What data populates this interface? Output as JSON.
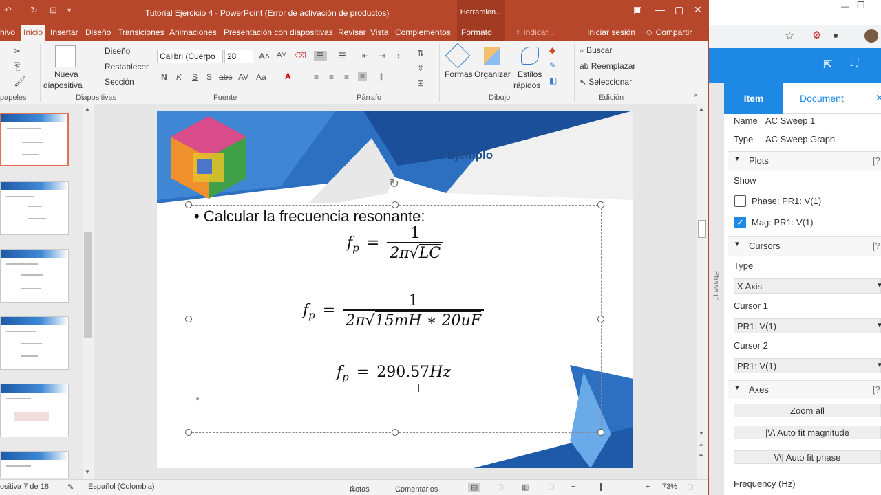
{
  "window": {
    "title": "Tutorial Ejercicio 4 - PowerPoint (Error de activación de productos)",
    "context_header": "Herramien...",
    "signin": "Iniciar sesión",
    "share": "Compartir"
  },
  "tabs": {
    "archivo": "hivo",
    "inicio": "Inicio",
    "insertar": "Insertar",
    "diseno": "Diseño",
    "transiciones": "Transiciones",
    "animaciones": "Animaciones",
    "presentacion": "Presentación con diapositivas",
    "revisar": "Revisar",
    "vista": "Vista",
    "complementos": "Complementos",
    "formato": "Formato",
    "indicar": "Indicar..."
  },
  "ribbon": {
    "nueva": "Nueva",
    "diapositiva": "diapositiva",
    "disenio": "Diseño",
    "restablecer": "Restablecer",
    "seccion": "Sección",
    "font_name": "Calibri (Cuerpo",
    "font_size": "28",
    "formas": "Formas",
    "organizar": "Organizar",
    "estilos": "Estilos",
    "rapidos": "rápidos",
    "buscar": "Buscar",
    "reemplazar": "Reemplazar",
    "seleccionar": "Seleccionar",
    "group_portapapeles": "papeles",
    "group_diapositivas": "Diapositivas",
    "group_fuente": "Fuente",
    "group_parrafo": "Párrafo",
    "group_dibujo": "Dibujo",
    "group_edicion": "Edición"
  },
  "slide": {
    "header": "Ejemplo",
    "bullet": "Calcular la frecuencia resonante:",
    "eq1_lhs": "f",
    "eq1_sub": "p",
    "eq1_num": "1",
    "eq1_den_a": "2π",
    "eq1_den_b": "LC",
    "eq2_num": "1",
    "eq2_den_a": "2π",
    "eq2_den_b": "15mH ∗ 20uF",
    "eq3_rhs_a": "290.57",
    "eq3_rhs_b": "Hz"
  },
  "statusbar": {
    "slide_info": "ositiva 7 de 18",
    "language": "Español (Colombia)",
    "notes": "Notas",
    "comments": "Comentarios",
    "zoom": "73%"
  },
  "panel": {
    "tab_item": "Item",
    "tab_document": "Document",
    "name_label": "Name",
    "name_value": "AC Sweep 1",
    "type_label": "Type",
    "type_value": "AC Sweep Graph",
    "plots": "Plots",
    "show": "Show",
    "phase": "Phase: PR1: V(1)",
    "mag": "Mag: PR1: V(1)",
    "cursors": "Cursors",
    "cursor_type_label": "Type",
    "cursor_type_value": "X Axis",
    "cursor1_label": "Cursor 1",
    "cursor1_value": "PR1: V(1)",
    "cursor2_label": "Cursor 2",
    "cursor2_value": "PR1: V(1)",
    "axes": "Axes",
    "zoom_all": "Zoom all",
    "auto_mag": "Auto fit magnitude",
    "auto_phase": "Auto fit phase",
    "frequency": "Frequency (Hz)",
    "side_label": "Phase (°",
    "help": "[?"
  },
  "colors": {
    "ppt_accent": "#b7472a",
    "panel_blue": "#1e88e5"
  }
}
